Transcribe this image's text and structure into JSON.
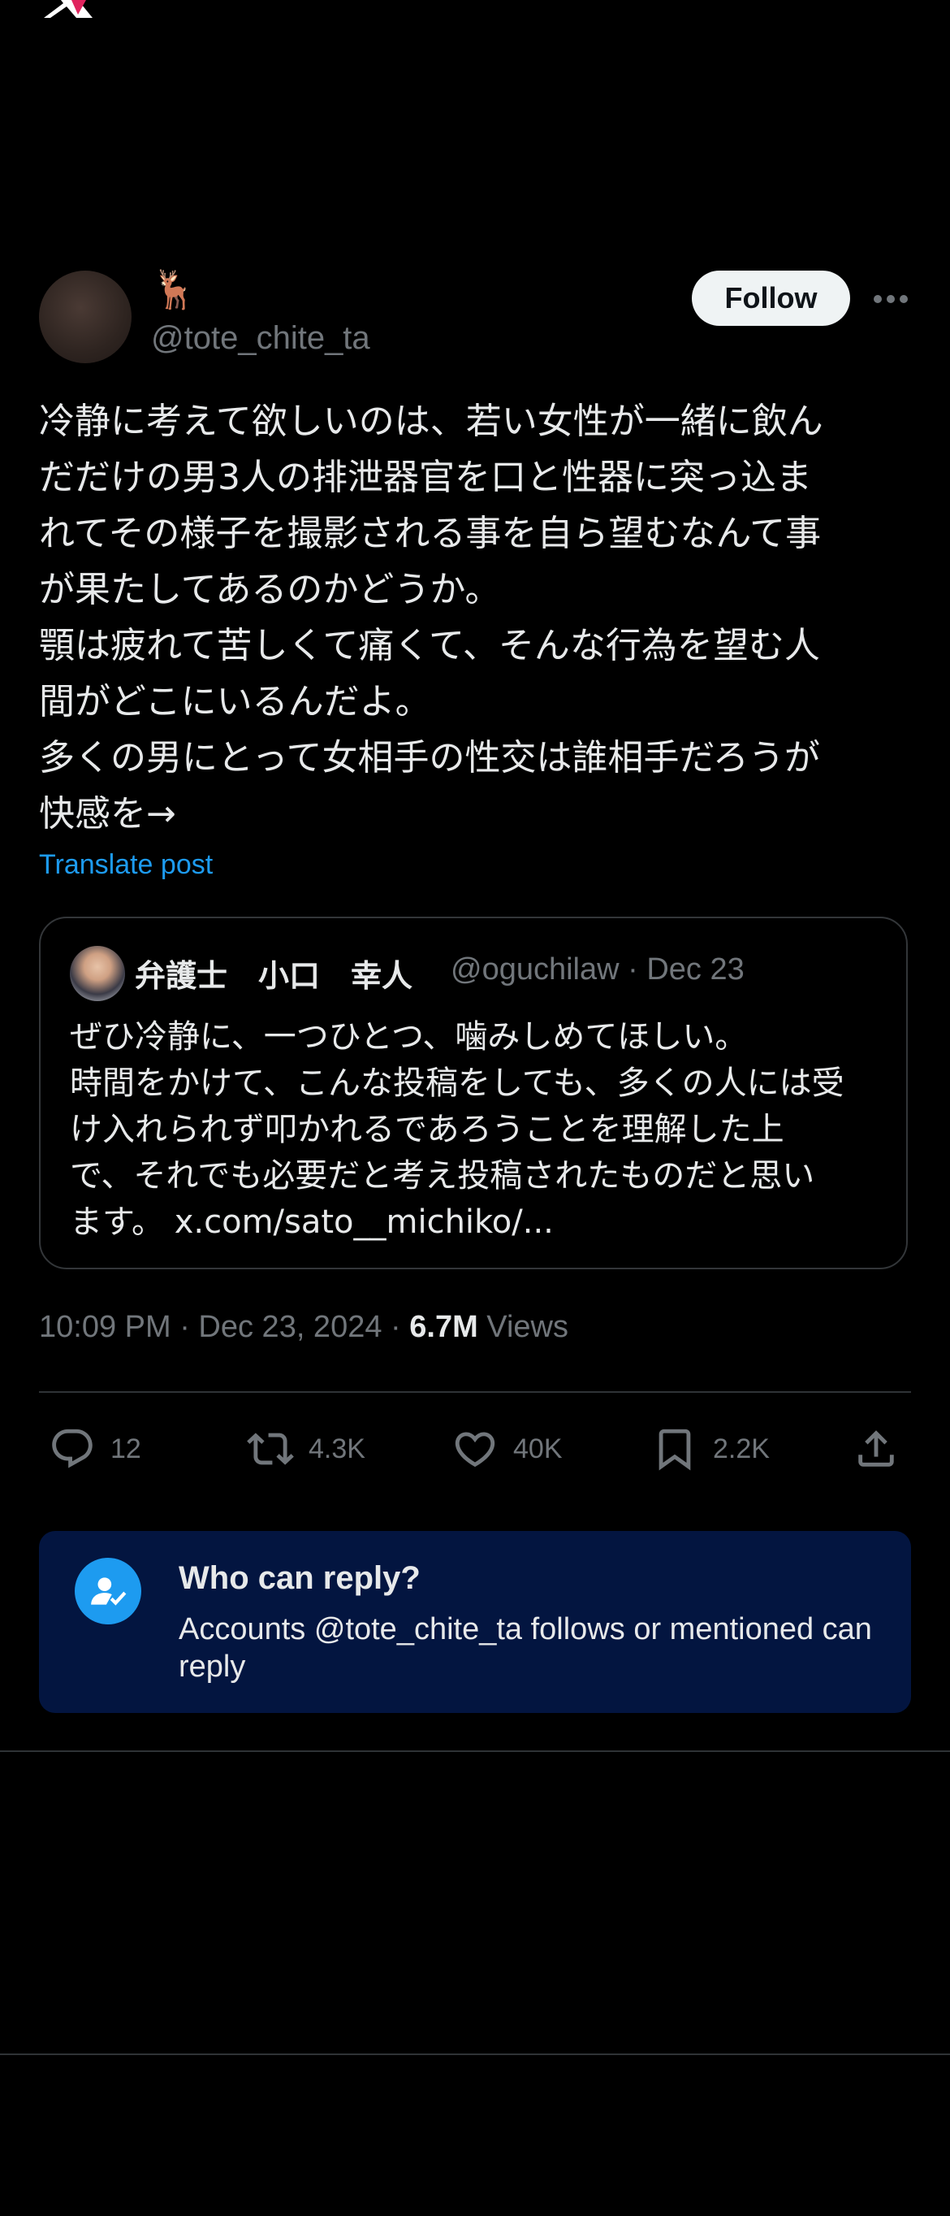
{
  "header": {
    "logo_icon": "x-logo-icon"
  },
  "post": {
    "author": {
      "display_name": "🦌",
      "handle": "@tote_chite_ta"
    },
    "follow_label": "Follow",
    "text": "冷静に考えて欲しいのは、若い女性が一緒に飲ん\nだだけの男3人の排泄器官を口と性器に突っ込ま\nれてその様子を撮影される事を自ら望むなんて事\nが果たしてあるのかどうか。\n顎は疲れて苦しくて痛くて、そんな行為を望む人\n間がどこにいるんだよ。\n多くの男にとって女相手の性交は誰相手だろうが\n快感を→",
    "translate_label": "Translate post",
    "quote": {
      "name": "弁護士　小口　幸人",
      "handle_date": "@oguchilaw · Dec 23",
      "text": "ぜひ冷静に、一つひとつ、噛みしめてほしい。\n時間をかけて、こんな投稿をしても、多くの人には受\nけ入れられず叩かれるであろうことを理解した上\nで、それでも必要だと考え投稿されたものだと思い\nます。 x.com/sato__michiko/..."
    },
    "timestamp": "10:09 PM · Dec 23, 2024 · ",
    "views_count": "6.7M",
    "views_label": " Views",
    "actions": {
      "replies": "12",
      "reposts": "4.3K",
      "likes": "40K",
      "bookmarks": "2.2K"
    }
  },
  "reply_settings": {
    "title": "Who can reply?",
    "description": "Accounts @tote_chite_ta follows or mentioned can reply"
  },
  "colors": {
    "accent": "#1d9bf0",
    "card_bg": "#031540",
    "muted": "#71767b"
  }
}
